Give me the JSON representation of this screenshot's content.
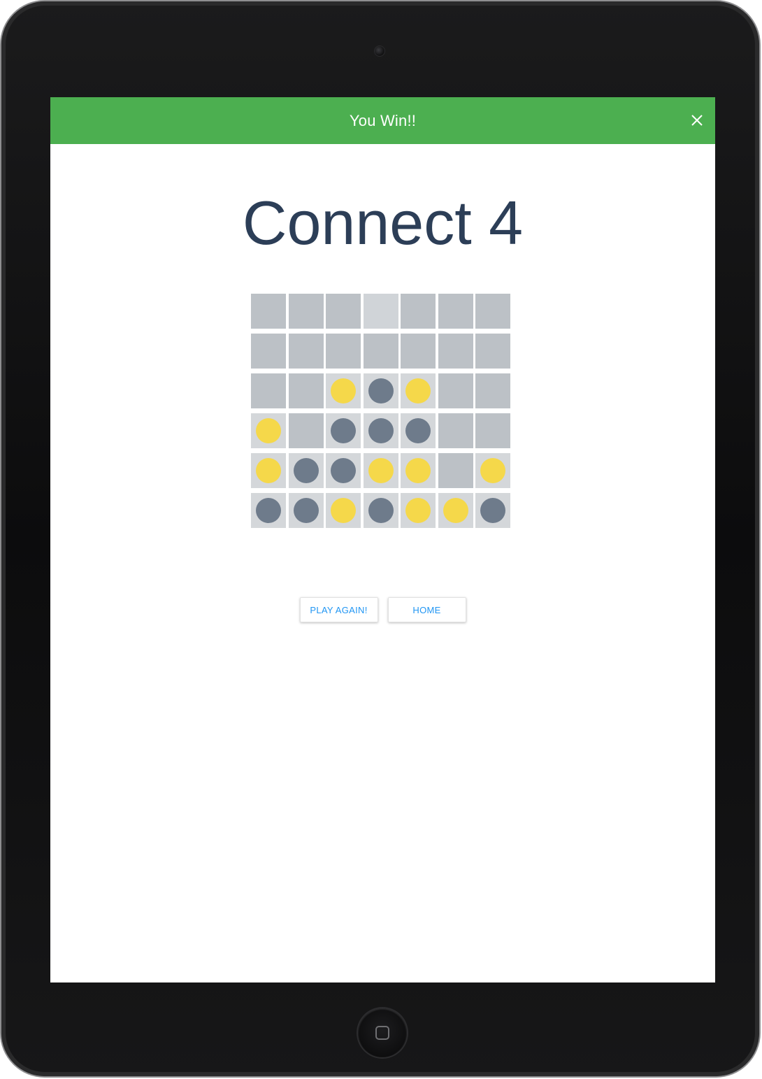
{
  "banner": {
    "text": "You Win!!",
    "color": "#4caf50"
  },
  "title": "Connect 4",
  "board": {
    "rows": 6,
    "cols": 7,
    "cells": [
      [
        "empty",
        "empty",
        "empty",
        "empty",
        "empty",
        "empty",
        "empty"
      ],
      [
        "empty",
        "empty",
        "empty",
        "empty",
        "empty",
        "empty",
        "empty"
      ],
      [
        "empty",
        "empty",
        "yellow",
        "gray",
        "yellow",
        "empty",
        "empty"
      ],
      [
        "yellow",
        "empty",
        "gray",
        "gray",
        "gray",
        "empty",
        "empty"
      ],
      [
        "yellow",
        "gray",
        "gray",
        "yellow",
        "yellow",
        "empty",
        "yellow"
      ],
      [
        "gray",
        "gray",
        "yellow",
        "gray",
        "yellow",
        "yellow",
        "gray"
      ]
    ],
    "colors": {
      "cell": "#bcc1c6",
      "yellow": "#f5d84a",
      "gray": "#6e7b8b"
    }
  },
  "buttons": {
    "play_again": "PLAY AGAIN!",
    "home": "HOME"
  },
  "icons": {
    "close": "close-icon",
    "home_hardware": "home-button-icon"
  }
}
